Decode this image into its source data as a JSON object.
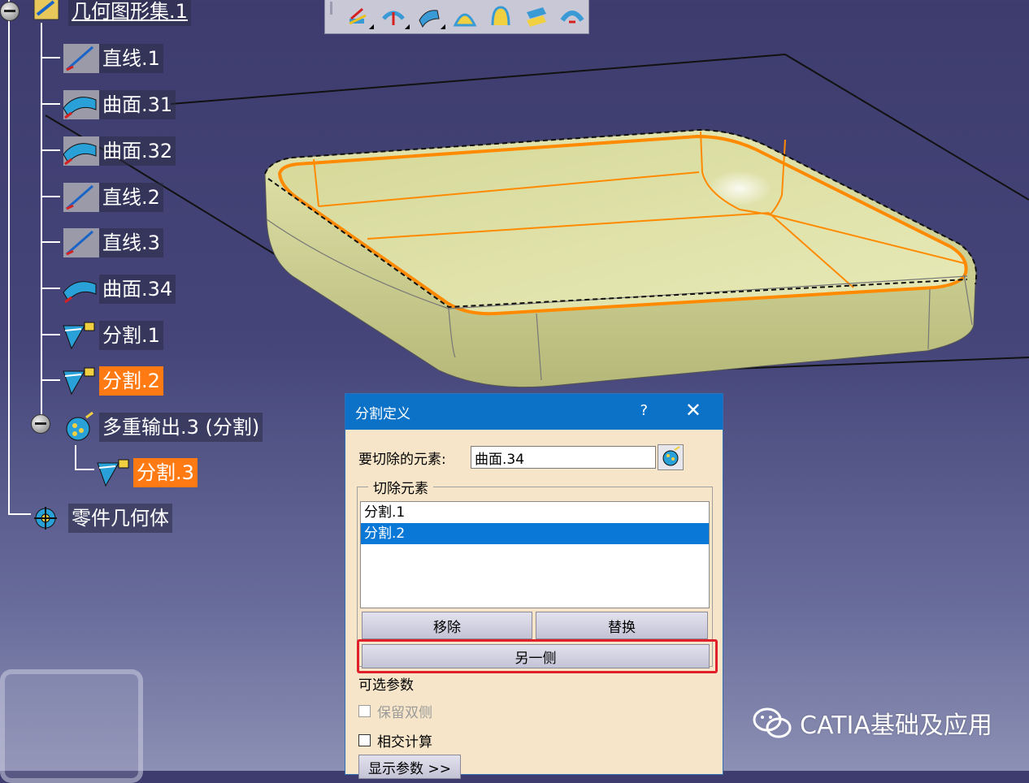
{
  "spec_tree": {
    "root_label": "几何图形集.1",
    "items": [
      {
        "label": "直线.1",
        "icon": "line-icon"
      },
      {
        "label": "曲面.31",
        "icon": "surface-icon"
      },
      {
        "label": "曲面.32",
        "icon": "surface-icon"
      },
      {
        "label": "直线.2",
        "icon": "line-icon"
      },
      {
        "label": "直线.3",
        "icon": "line-icon"
      },
      {
        "label": "曲面.34",
        "icon": "surface-icon"
      },
      {
        "label": "分割.1",
        "icon": "split-icon"
      },
      {
        "label": "分割.2",
        "icon": "split-icon",
        "selected": true
      },
      {
        "label": "多重输出.3 (分割)",
        "icon": "multi-output-icon"
      },
      {
        "label": "分割.3",
        "icon": "split-icon",
        "selected": true
      },
      {
        "label": "零件几何体",
        "icon": "part-body-icon"
      }
    ]
  },
  "toolbar": {
    "buttons": [
      {
        "icon": "extrude-surface-icon",
        "has_dropdown": true
      },
      {
        "icon": "offset-surface-icon",
        "has_dropdown": true
      },
      {
        "icon": "sweep-surface-icon",
        "has_dropdown": true
      },
      {
        "icon": "fill-surface-icon",
        "has_dropdown": false
      },
      {
        "icon": "multi-section-surface-icon",
        "has_dropdown": false
      },
      {
        "icon": "blend-surface-icon",
        "has_dropdown": false
      },
      {
        "icon": "revolve-surface-icon",
        "has_dropdown": false
      }
    ]
  },
  "dialog": {
    "title": "分割定义",
    "help": "?",
    "close": "✕",
    "element_label": "要切除的元素:",
    "element_value": "曲面.34",
    "cutting_group_label": "切除元素",
    "cutting_elements": [
      {
        "label": "分割.1",
        "selected": false
      },
      {
        "label": "分割.2",
        "selected": true
      }
    ],
    "remove_button": "移除",
    "replace_button": "替换",
    "other_side_button": "另一侧",
    "optional_params_label": "可选参数",
    "keep_both_sides": {
      "label": "保留双侧",
      "checked": false,
      "enabled": false
    },
    "intersections": {
      "label": "相交计算",
      "checked": false,
      "enabled": true
    },
    "show_params_button": "显示参数 >>"
  },
  "watermark": {
    "text": "CATIA基础及应用"
  },
  "colors": {
    "background": "#3e3c6e",
    "selection_orange": "#ff7a12",
    "dialog_title": "#0c72c8",
    "dialog_body": "#f6e5c8",
    "highlight_red": "#e0202a",
    "part_surface": "#d8dc9c",
    "edge_orange": "#ff8a00"
  }
}
